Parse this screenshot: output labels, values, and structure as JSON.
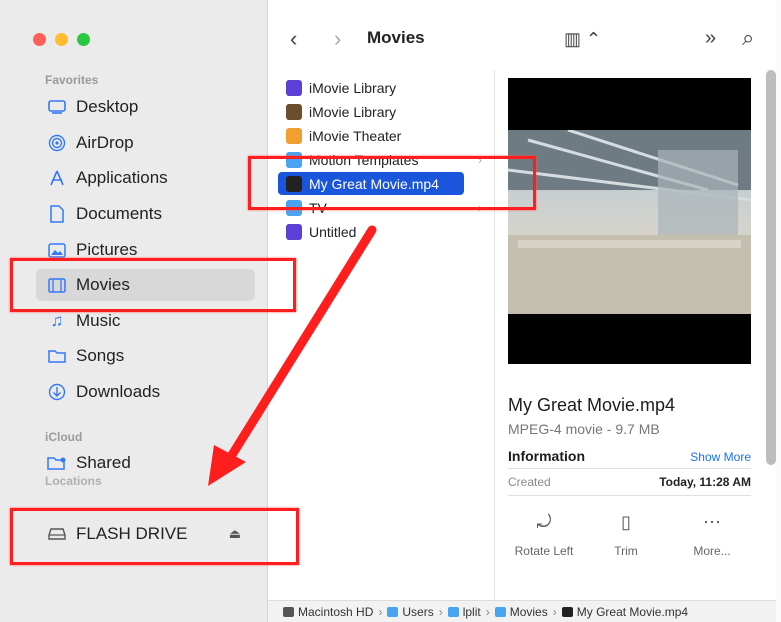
{
  "window": {
    "title": "Movies",
    "traffic_lights": {
      "close": "#ff5f57",
      "minimize": "#febc2e",
      "zoom": "#28c840"
    }
  },
  "sidebar": {
    "sections": [
      {
        "title": "Favorites"
      },
      {
        "title": "iCloud"
      },
      {
        "title": "Locations"
      }
    ],
    "favorites": [
      {
        "label": "Desktop",
        "icon": "desktop-icon"
      },
      {
        "label": "AirDrop",
        "icon": "airdrop-icon"
      },
      {
        "label": "Applications",
        "icon": "applications-icon"
      },
      {
        "label": "Documents",
        "icon": "document-icon"
      },
      {
        "label": "Pictures",
        "icon": "pictures-icon"
      },
      {
        "label": "Movies",
        "icon": "movies-icon",
        "selected": true
      },
      {
        "label": "Music",
        "icon": "music-icon"
      },
      {
        "label": "Songs",
        "icon": "folder-icon"
      },
      {
        "label": "Downloads",
        "icon": "downloads-icon"
      }
    ],
    "icloud": [
      {
        "label": "Shared",
        "icon": "shared-folder-icon"
      }
    ],
    "locations": [
      {
        "label": "FLASH DRIVE",
        "icon": "drive-icon"
      }
    ]
  },
  "toolbar": {
    "back": "‹",
    "forward": "›",
    "title": "Movies",
    "view": "▥ ⌃",
    "more": "»",
    "search": "⌕"
  },
  "files": [
    {
      "name": "iMovie Library",
      "color": "#5b3fd6"
    },
    {
      "name": "iMovie Library",
      "color": "#6b4e2e"
    },
    {
      "name": "iMovie Theater",
      "color": "#f0a030"
    },
    {
      "name": "Motion Templates",
      "color": "#4aa3f0",
      "folder": true
    },
    {
      "name": "My Great Movie.mp4",
      "color": "#222222",
      "selected": true
    },
    {
      "name": "TV",
      "color": "#4aa3f0",
      "folder": true
    },
    {
      "name": "Untitled",
      "color": "#5b3fd6"
    }
  ],
  "preview": {
    "title": "My Great Movie.mp4",
    "subtitle": "MPEG-4 movie - 9.7 MB",
    "info_label": "Information",
    "show_more": "Show More",
    "created_label": "Created",
    "created_value": "Today, 11:28 AM",
    "actions": [
      {
        "label": "Rotate Left",
        "icon": "rotate-left-icon",
        "glyph": "⤾"
      },
      {
        "label": "Trim",
        "icon": "trim-icon",
        "glyph": "▯"
      },
      {
        "label": "More...",
        "icon": "more-icon",
        "glyph": "⋯"
      }
    ]
  },
  "pathbar": {
    "items": [
      {
        "label": "Macintosh HD",
        "color": "#555555"
      },
      {
        "label": "Users",
        "color": "#4aa3f0"
      },
      {
        "label": "lplit",
        "color": "#4aa3f0"
      },
      {
        "label": "Movies",
        "color": "#4aa3f0"
      },
      {
        "label": "My Great Movie.mp4",
        "color": "#222222"
      }
    ],
    "separator": "›"
  },
  "colors": {
    "accent": "#1a56db",
    "annotation_red": "#ff1e1e"
  }
}
